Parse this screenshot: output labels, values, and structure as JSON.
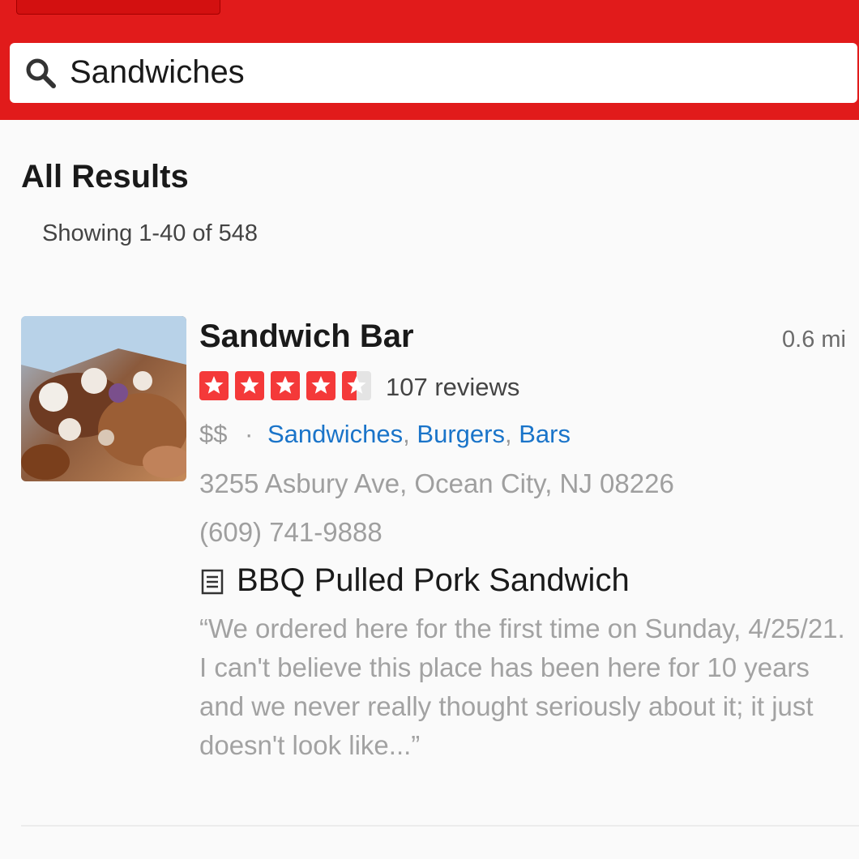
{
  "search": {
    "value": "Sandwiches"
  },
  "results": {
    "section_title": "All Results",
    "showing_text": "Showing 1-40 of 548",
    "items": [
      {
        "name": "Sandwich Bar",
        "distance": "0.6 mi",
        "rating": 4.5,
        "review_count_text": "107 reviews",
        "price": "$$",
        "separator": "·",
        "categories": [
          "Sandwiches",
          "Burgers",
          "Bars"
        ],
        "category_sep_1": ",",
        "category_sep_2": ",",
        "address": "3255 Asbury Ave, Ocean City, NJ 08226",
        "phone": "(609) 741-9888",
        "menu_item": "BBQ Pulled Pork Sandwich",
        "review_snippet": "“We ordered here for the first time on Sunday, 4/25/21. I can't believe this place has been here for 10 years and we never really thought seriously about it; it just doesn't look like...”"
      }
    ]
  },
  "colors": {
    "brand_red": "#e11b1b",
    "star_red": "#f43939",
    "link_blue": "#1a74c9"
  },
  "icons": {
    "search": "search-icon",
    "menu": "menu-item-icon",
    "star": "star-icon"
  }
}
